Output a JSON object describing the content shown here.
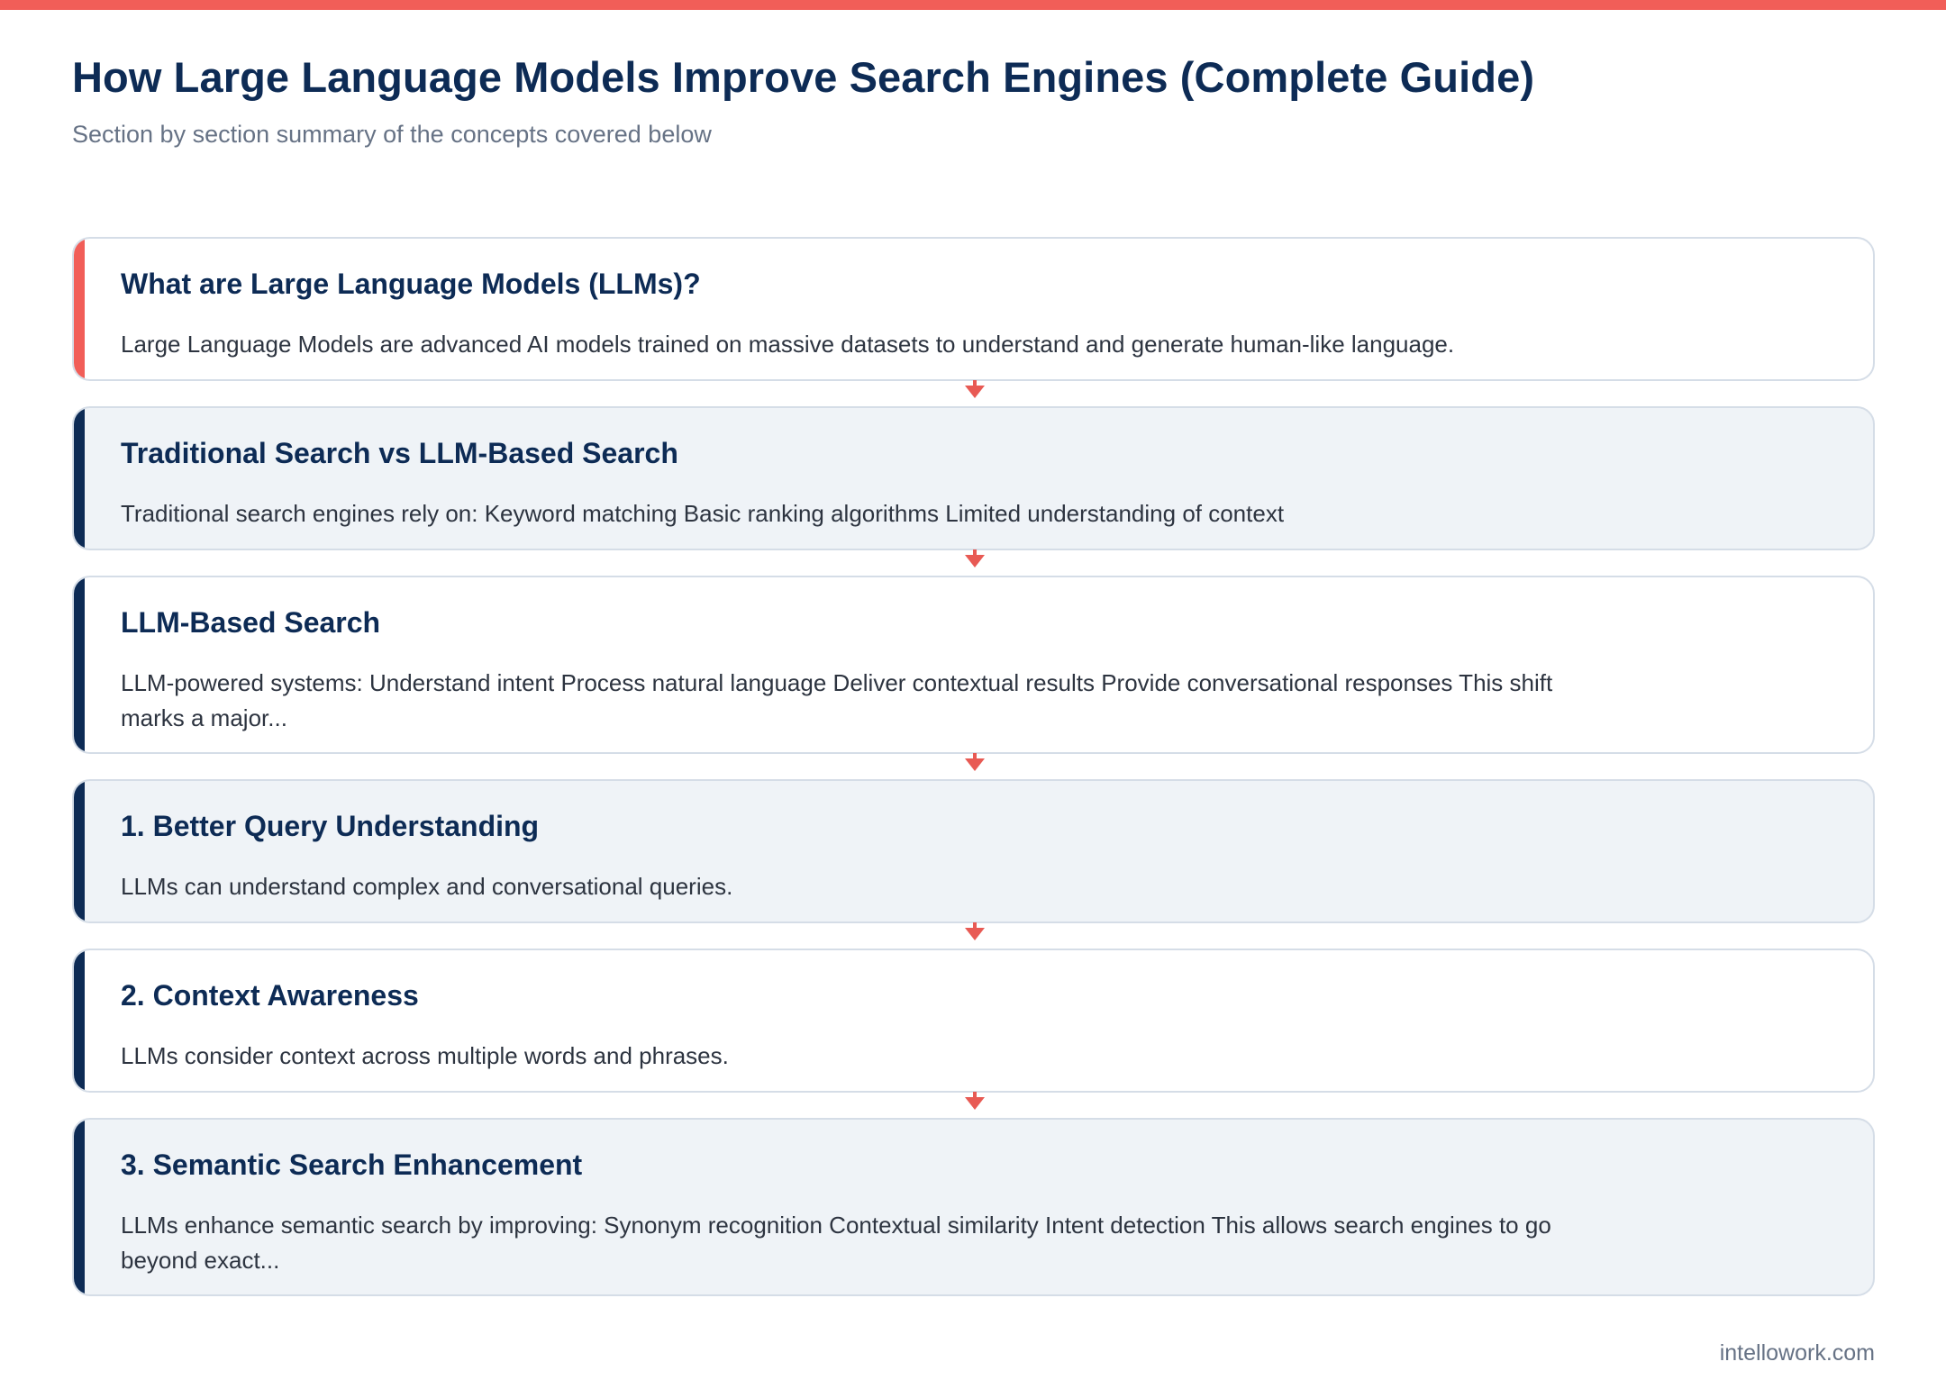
{
  "header": {
    "title": "How Large Language Models Improve Search Engines (Complete Guide)",
    "subtitle": "Section by section summary of the concepts covered below"
  },
  "colors": {
    "top_bar": "#f15e58",
    "title": "#0d2b55",
    "accent_first": "#f15e58",
    "accent_other": "#0d2b55",
    "arrow": "#e85a54",
    "card_alt_bg": "#eff3f7"
  },
  "sections": [
    {
      "heading": "What are Large Language Models (LLMs)?",
      "text": "Large Language Models are advanced AI models trained on massive datasets to understand and generate human-like language."
    },
    {
      "heading": "Traditional Search vs LLM-Based Search",
      "text": "Traditional search engines rely on: Keyword matching Basic ranking algorithms Limited understanding of context"
    },
    {
      "heading": "LLM-Based Search",
      "text": "LLM-powered systems: Understand intent Process natural language Deliver contextual results Provide conversational responses This shift marks a major..."
    },
    {
      "heading": "1. Better Query Understanding",
      "text": "LLMs can understand complex and conversational queries."
    },
    {
      "heading": "2. Context Awareness",
      "text": "LLMs consider context across multiple words and phrases."
    },
    {
      "heading": "3. Semantic Search Enhancement",
      "text": "LLMs enhance semantic search by improving: Synonym recognition Contextual similarity Intent detection This allows search engines to go beyond exact..."
    }
  ],
  "footer": {
    "source": "intellowork.com"
  }
}
